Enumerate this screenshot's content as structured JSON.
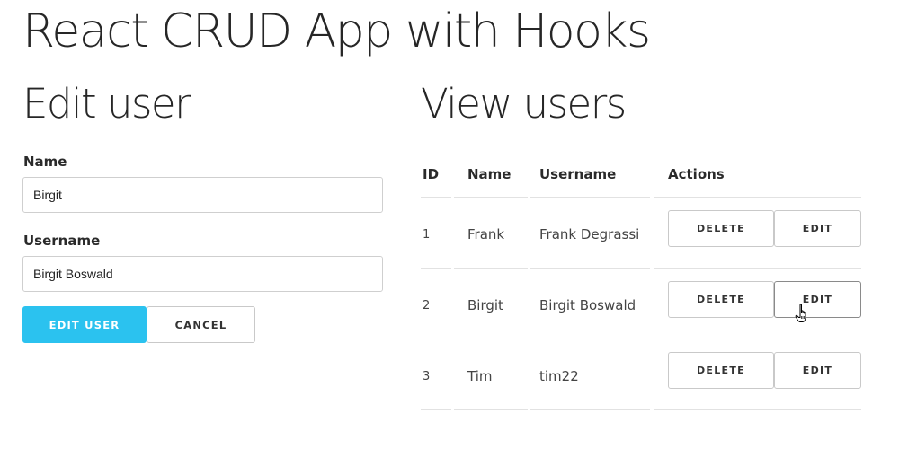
{
  "app": {
    "title": "React CRUD App with Hooks"
  },
  "edit_form": {
    "title": "Edit user",
    "name_label": "Name",
    "name_value": "Birgit",
    "username_label": "Username",
    "username_value": "Birgit Boswald",
    "submit_label": "EDIT USER",
    "cancel_label": "CANCEL",
    "submit_color": "#2bc2ef"
  },
  "users_table": {
    "title": "View users",
    "columns": [
      "ID",
      "Name",
      "Username",
      "Actions"
    ],
    "rows": [
      {
        "id": "1",
        "name": "Frank",
        "username": "Frank Degrassi",
        "delete_label": "DELETE",
        "edit_label": "EDIT"
      },
      {
        "id": "2",
        "name": "Birgit",
        "username": "Birgit Boswald",
        "delete_label": "DELETE",
        "edit_label": "EDIT"
      },
      {
        "id": "3",
        "name": "Tim",
        "username": "tim22",
        "delete_label": "DELETE",
        "edit_label": "EDIT"
      }
    ]
  },
  "cursor": {
    "icon": "hand-pointer-icon",
    "hovering": "row 2 edit button"
  }
}
